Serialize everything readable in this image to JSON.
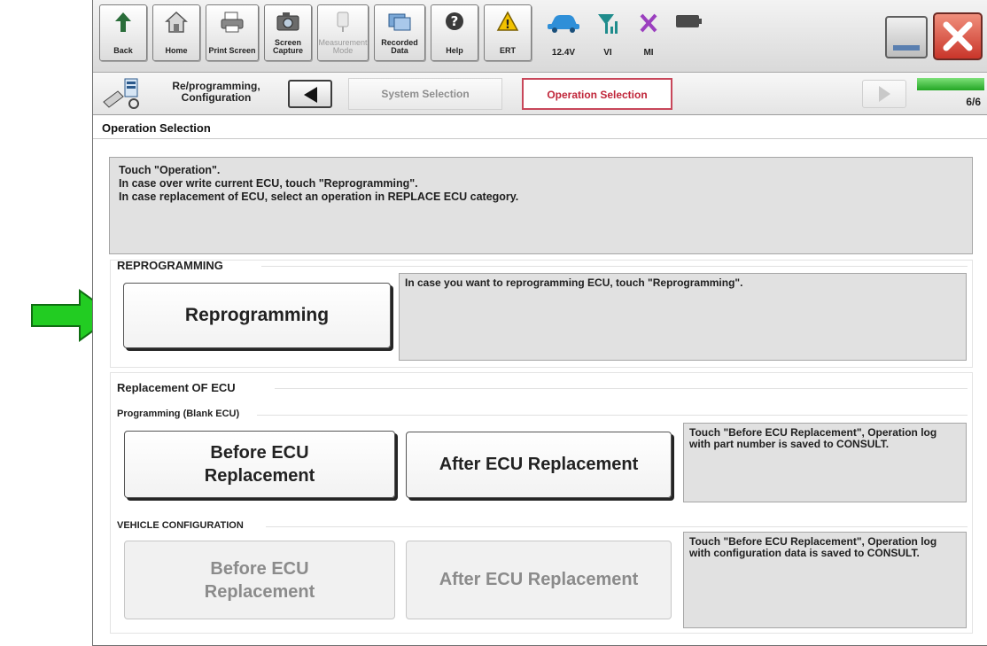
{
  "toolbar": {
    "buttons": [
      {
        "label": "Back",
        "icon": "back-arrow-icon"
      },
      {
        "label": "Home",
        "icon": "home-icon"
      },
      {
        "label": "Print Screen",
        "icon": "printer-icon"
      },
      {
        "label": "Screen Capture",
        "icon": "camera-icon"
      },
      {
        "label": "Measurement Mode",
        "icon": "measurement-icon",
        "disabled": true
      },
      {
        "label": "Recorded Data",
        "icon": "recorded-data-icon"
      },
      {
        "label": "Help",
        "icon": "help-icon"
      },
      {
        "label": "ERT",
        "icon": "warning-icon"
      }
    ],
    "status": {
      "voltage": "12.4V",
      "vi": "VI",
      "mi": "MI"
    }
  },
  "breadcrumb": {
    "app_label": "Re/programming, Configuration",
    "steps": [
      "System Selection",
      "Operation Selection"
    ],
    "active_step": "Operation Selection",
    "progress_text": "6/6",
    "progress_fraction": 1.0
  },
  "page": {
    "title": "Operation Selection",
    "instructions": [
      "Touch \"Operation\".",
      "In case over write current ECU, touch \"Reprogramming\".",
      "In case replacement of ECU, select an operation in REPLACE ECU category."
    ]
  },
  "reprogramming": {
    "section_title": "REPROGRAMMING",
    "button_label": "Reprogramming",
    "description": "In case you want to reprogramming ECU, touch \"Reprogramming\"."
  },
  "replacement": {
    "section_title": "Replacement OF ECU",
    "programming": {
      "subtitle": "Programming (Blank ECU)",
      "before_label": "Before ECU Replacement",
      "after_label": "After ECU Replacement",
      "description": "Touch \"Before ECU Replacement\", Operation log with part number is saved to CONSULT."
    },
    "vehicle_configuration": {
      "subtitle": "VEHICLE CONFIGURATION",
      "before_label": "Before ECU Replacement",
      "after_label": "After ECU Replacement",
      "description": "Touch \"Before ECU Replacement\", Operation log with configuration data is saved to CONSULT."
    }
  },
  "colors": {
    "annotation_arrow": "#22cc22",
    "active_crumb": "#c8475a",
    "progress": "#23a624",
    "close_button": "#d9483a"
  }
}
